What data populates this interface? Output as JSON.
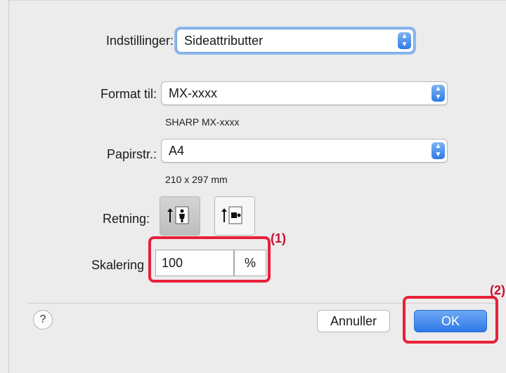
{
  "settings": {
    "label": "Indstillinger:",
    "value": "Sideattributter"
  },
  "format": {
    "label": "Format til:",
    "value": "MX-xxxx",
    "printer_name": "SHARP MX-xxxx"
  },
  "paper": {
    "label": "Papirstr.:",
    "value": "A4",
    "dimensions": "210 x 297 mm"
  },
  "orientation": {
    "label": "Retning:",
    "selected": "portrait"
  },
  "scaling": {
    "label": "Skalering",
    "value": "100",
    "unit": "%"
  },
  "callouts": {
    "one": "(1)",
    "two": "(2)"
  },
  "buttons": {
    "help": "?",
    "cancel": "Annuller",
    "ok": "OK"
  },
  "icons": {
    "stepper": "up-down-chevron-icon",
    "portrait": "portrait-orientation-icon",
    "landscape": "landscape-orientation-icon"
  },
  "colors": {
    "accent": "#2e79e8",
    "highlight": "#e8203a",
    "callout": "#c8102e"
  }
}
